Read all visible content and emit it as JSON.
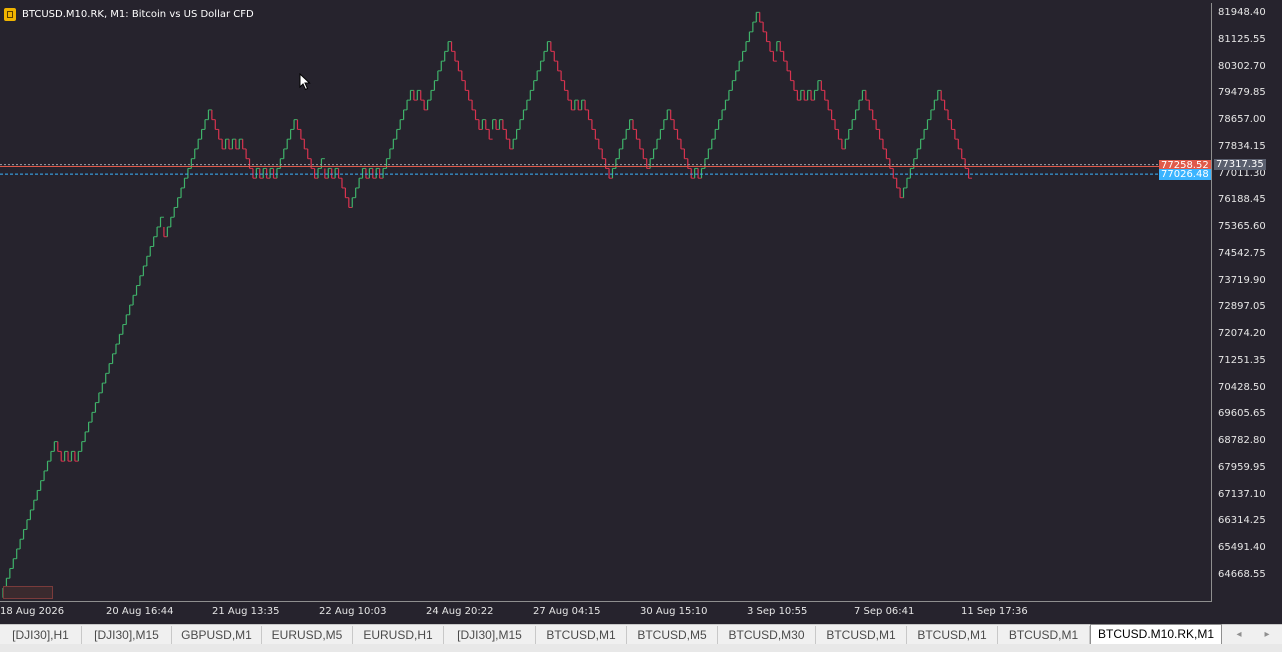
{
  "window": {
    "symbol_title": "BTCUSD.M10.RK, M1:  Bitcoin vs US Dollar CFD"
  },
  "colors": {
    "background": "#26232d",
    "bull": "#3fb36a",
    "bear": "#d8334f",
    "bid_line": "#e05a4a",
    "ask_line": "#3ab4ff",
    "last_label_bg": "#5a5f6e"
  },
  "price_axis": {
    "ticks": [
      "81948.40",
      "81125.55",
      "80302.70",
      "79479.85",
      "78657.00",
      "77834.15",
      "77011.30",
      "76188.45",
      "75365.60",
      "74542.75",
      "73719.90",
      "72897.05",
      "72074.20",
      "71251.35",
      "70428.50",
      "69605.65",
      "68782.80",
      "67959.95",
      "67137.10",
      "66314.25",
      "65491.40",
      "64668.55"
    ],
    "min": 64156,
    "max": 82450
  },
  "time_axis": {
    "ticks": [
      "18 Aug 2026",
      "20 Aug 16:44",
      "21 Aug 13:35",
      "22 Aug 10:03",
      "24 Aug 20:22",
      "27 Aug 04:15",
      "30 Aug 15:10",
      "3 Sep 10:55",
      "7 Sep 06:41",
      "11 Sep 17:36"
    ]
  },
  "price_markers": {
    "bid": "77258.52",
    "last": "77317.35",
    "ask": "77026.48"
  },
  "chart_data": {
    "type": "renko",
    "brick_size": 300,
    "start_price": 64300,
    "closes": [
      64300,
      64600,
      64900,
      65200,
      65500,
      65800,
      66100,
      66400,
      66700,
      67000,
      67300,
      67600,
      67900,
      68200,
      68500,
      68800,
      68500,
      68200,
      68500,
      68200,
      68500,
      68200,
      68500,
      68800,
      69100,
      69400,
      69700,
      70000,
      70300,
      70600,
      70900,
      71200,
      71500,
      71800,
      72100,
      72400,
      72700,
      73000,
      73300,
      73600,
      73900,
      74200,
      74500,
      74800,
      75100,
      75400,
      75700,
      75100,
      75400,
      75700,
      76000,
      76300,
      76600,
      76900,
      77200,
      77500,
      77800,
      78100,
      78400,
      78700,
      79000,
      78700,
      78400,
      78100,
      77800,
      78100,
      77800,
      78100,
      77800,
      78100,
      77800,
      77500,
      77200,
      76900,
      77200,
      76900,
      77200,
      76900,
      77200,
      76900,
      77200,
      77500,
      77800,
      78100,
      78400,
      78700,
      78400,
      78100,
      77800,
      77500,
      77200,
      76900,
      77200,
      77500,
      76900,
      77200,
      76900,
      77200,
      76900,
      76600,
      76300,
      76000,
      76300,
      76600,
      76900,
      77200,
      76900,
      77200,
      76900,
      77200,
      76900,
      77200,
      77500,
      77800,
      78100,
      78400,
      78700,
      79000,
      79300,
      79600,
      79300,
      79600,
      79300,
      79000,
      79300,
      79600,
      79900,
      80200,
      80500,
      80800,
      81100,
      80800,
      80500,
      80200,
      79900,
      79600,
      79300,
      79000,
      78700,
      78400,
      78700,
      78400,
      78100,
      78700,
      78400,
      78700,
      78400,
      78100,
      77800,
      78100,
      78400,
      78700,
      79000,
      79300,
      79600,
      79900,
      80200,
      80500,
      80800,
      81100,
      80800,
      80500,
      80200,
      79900,
      79600,
      79300,
      79000,
      79300,
      79000,
      79300,
      79000,
      78700,
      78400,
      78100,
      77800,
      77500,
      77200,
      76900,
      77200,
      77500,
      77800,
      78100,
      78400,
      78700,
      78400,
      78100,
      77800,
      77500,
      77200,
      77500,
      77800,
      78100,
      78400,
      78700,
      79000,
      78700,
      78400,
      78100,
      77800,
      77500,
      77200,
      76900,
      77200,
      76900,
      77200,
      77500,
      77800,
      78100,
      78400,
      78700,
      79000,
      79300,
      79600,
      79900,
      80200,
      80500,
      80800,
      81100,
      81400,
      81700,
      82000,
      81700,
      81400,
      81100,
      80800,
      80500,
      81100,
      80800,
      80500,
      80200,
      79900,
      79600,
      79300,
      79600,
      79300,
      79600,
      79300,
      79600,
      79900,
      79600,
      79300,
      79000,
      78700,
      78400,
      78100,
      77800,
      78100,
      78400,
      78700,
      79000,
      79300,
      79600,
      79300,
      79000,
      78700,
      78400,
      78100,
      77800,
      77500,
      77200,
      76900,
      76600,
      76300,
      76600,
      76900,
      77200,
      77500,
      77800,
      78100,
      78400,
      78700,
      79000,
      79300,
      79600,
      79300,
      79000,
      78700,
      78400,
      78100,
      77800,
      77500,
      77200,
      76900
    ]
  },
  "tabs": [
    {
      "label": "[DJI30],H1"
    },
    {
      "label": "[DJI30],M15"
    },
    {
      "label": "GBPUSD,M1"
    },
    {
      "label": "EURUSD,M5"
    },
    {
      "label": "EURUSD,H1"
    },
    {
      "label": "[DJI30],M15"
    },
    {
      "label": "BTCUSD,M1"
    },
    {
      "label": "BTCUSD,M5"
    },
    {
      "label": "BTCUSD,M30"
    },
    {
      "label": "BTCUSD,M1"
    },
    {
      "label": "BTCUSD,M1"
    },
    {
      "label": "BTCUSD,M1"
    },
    {
      "label": "BTCUSD.M10.RK,M1"
    }
  ],
  "active_tab_index": 12,
  "tab_nav": {
    "left": "◂",
    "right": "▸"
  }
}
